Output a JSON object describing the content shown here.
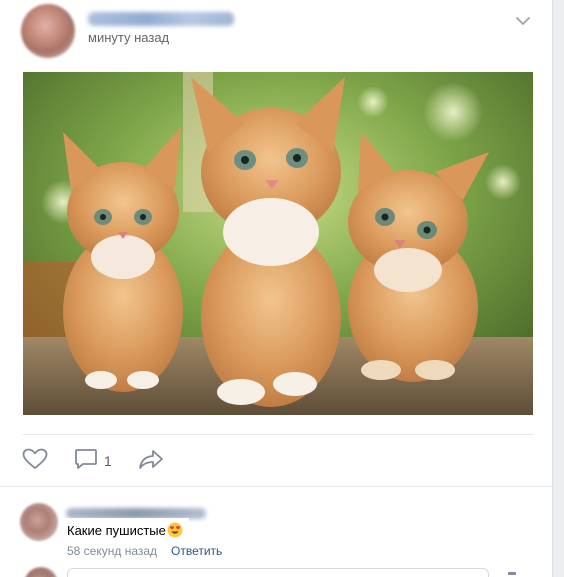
{
  "post": {
    "time": "минуту назад",
    "image_alt": "Три рыжих котёнка"
  },
  "actions": {
    "comments_count": "1"
  },
  "comment": {
    "text": "Какие пушистые",
    "emoji": "smiling-face-with-heart-eyes",
    "time": "58 секунд назад",
    "reply_label": "Ответить"
  },
  "colors": {
    "link": "#2a5885",
    "icon": "#828a99",
    "meta": "#818c99"
  }
}
